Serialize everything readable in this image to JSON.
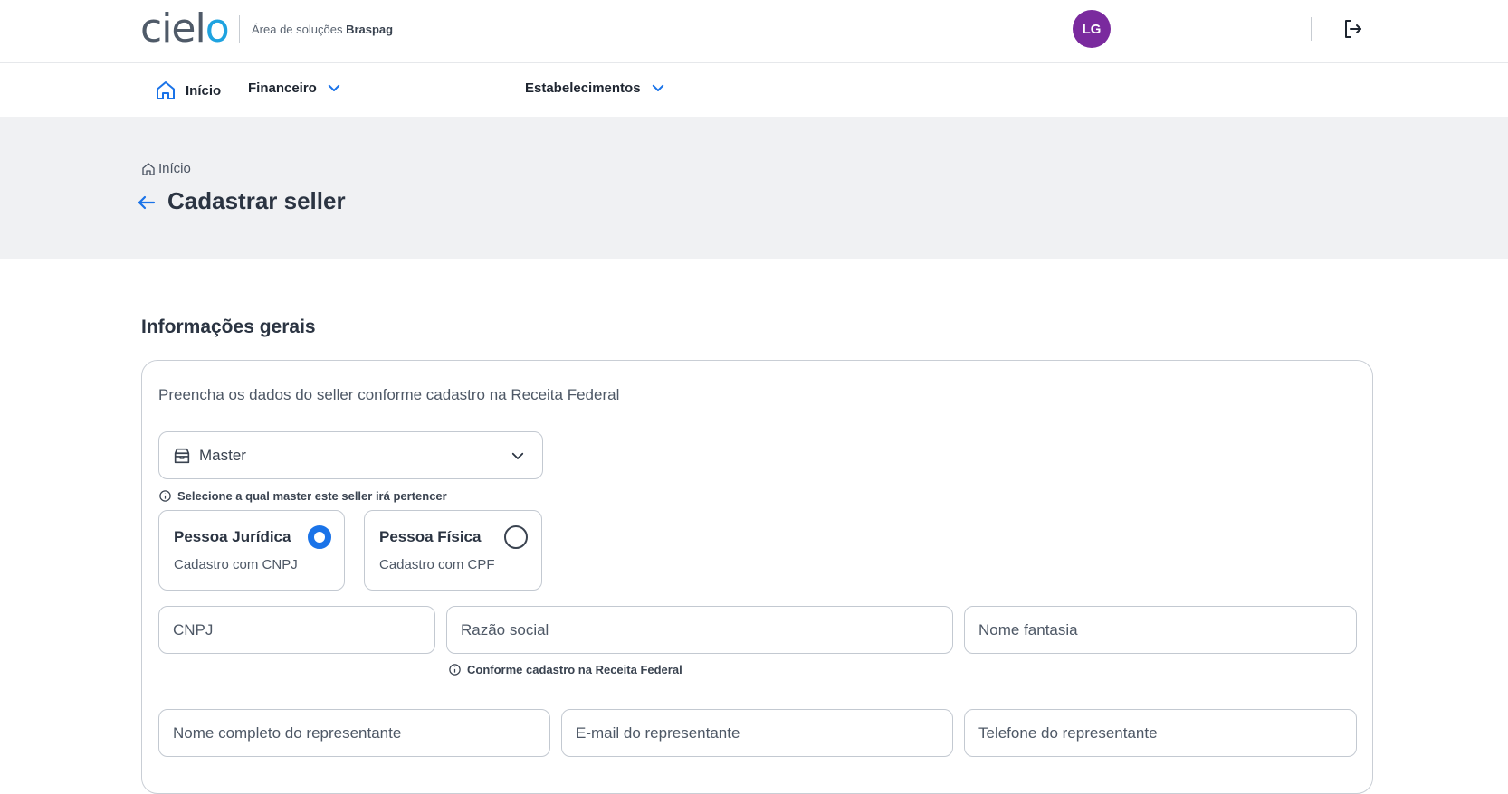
{
  "header": {
    "logo_main": "ciel",
    "logo_o": "o",
    "subtitle_prefix": "Área de soluções",
    "subtitle_brand": "Braspag",
    "avatar_initials": "LG"
  },
  "nav": {
    "home": "Início",
    "financeiro": "Financeiro",
    "estabelecimentos": "Estabelecimentos"
  },
  "page": {
    "breadcrumb": "Início",
    "title": "Cadastrar seller"
  },
  "form": {
    "section_title": "Informações gerais",
    "description": "Preencha os dados do seller conforme cadastro na Receita Federal",
    "master_select": {
      "value": "Master",
      "hint": "Selecione a qual master este seller irá pertencer"
    },
    "person_type": {
      "juridica_title": "Pessoa Jurídica",
      "juridica_sub": "Cadastro com CNPJ",
      "fisica_title": "Pessoa Física",
      "fisica_sub": "Cadastro com CPF",
      "selected": "juridica"
    },
    "fields": {
      "cnpj_placeholder": "CNPJ",
      "razao_placeholder": "Razão social",
      "razao_hint": "Conforme cadastro na Receita Federal",
      "fantasia_placeholder": "Nome fantasia",
      "rep_name_placeholder": "Nome completo do representante",
      "rep_email_placeholder": "E-mail do representante",
      "rep_phone_placeholder": "Telefone do representante"
    }
  },
  "colors": {
    "accent": "#1a73e8",
    "avatar": "#7a2a9e",
    "logo_o": "#1fa3e0"
  }
}
